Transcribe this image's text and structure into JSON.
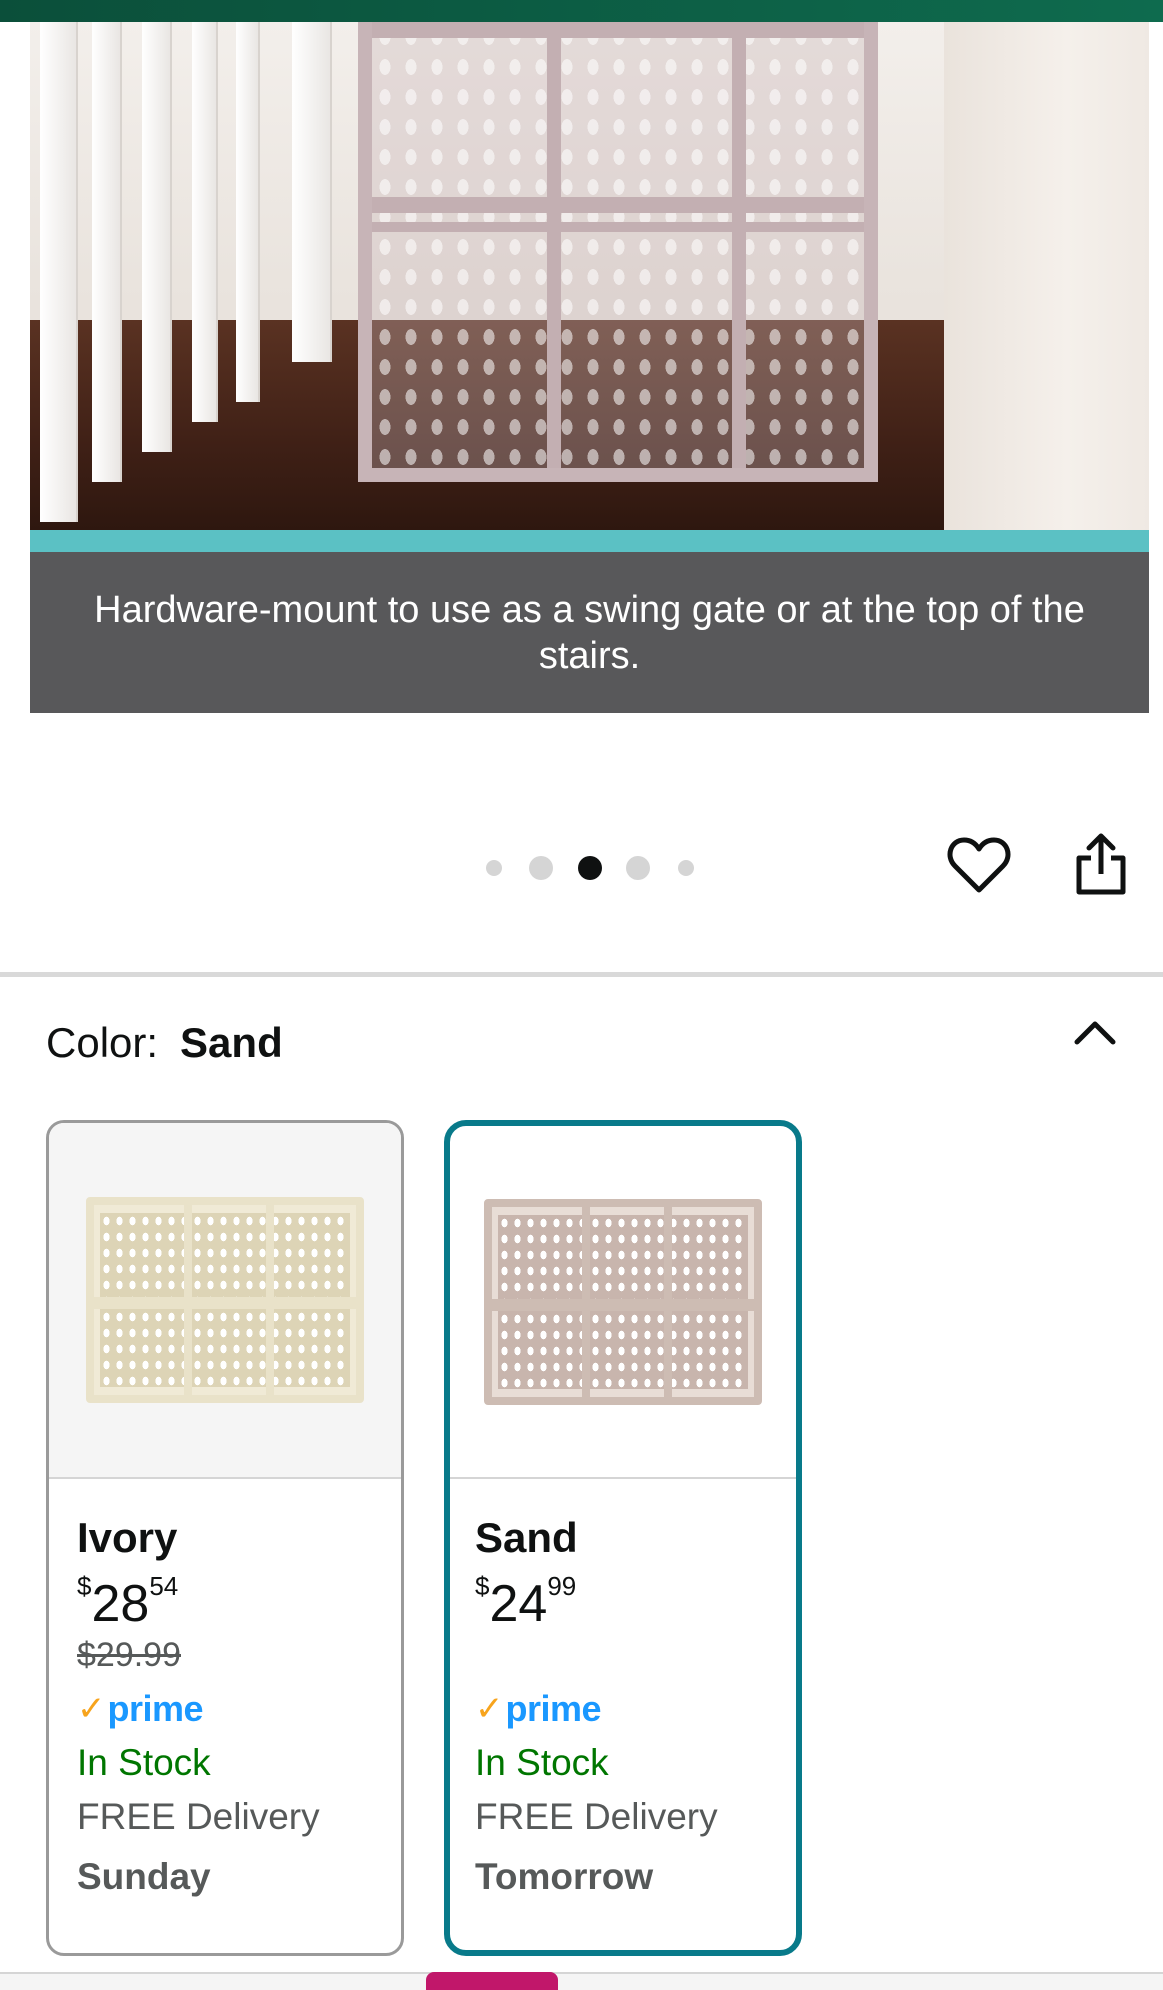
{
  "hero": {
    "caption": "Hardware-mount to use as a swing gate or at the top of the stairs.",
    "image_count": 5,
    "active_index": 2
  },
  "actions": {
    "favorite_icon": "heart-outline-icon",
    "share_icon": "share-icon"
  },
  "color_selector": {
    "label": "Color:",
    "selected_value": "Sand",
    "collapse_icon": "chevron-up-icon"
  },
  "swatches": [
    {
      "name": "Ivory",
      "price_currency": "$",
      "price_whole": "28",
      "price_fraction": "54",
      "list_price": "$29.99",
      "prime_label": "prime",
      "stock": "In Stock",
      "delivery": "FREE Delivery",
      "delivery_day": "Sunday",
      "selected": false,
      "gate_color": "#e9e2c9"
    },
    {
      "name": "Sand",
      "price_currency": "$",
      "price_whole": "24",
      "price_fraction": "99",
      "list_price": "",
      "prime_label": "prime",
      "stock": "In Stock",
      "delivery": "FREE Delivery",
      "delivery_day": "Tomorrow",
      "selected": true,
      "gate_color": "#cdbcb3"
    }
  ],
  "colors": {
    "selected_border": "#087a8a",
    "in_stock": "#007600",
    "prime_blue": "#1a98ff",
    "prime_check": "#f7a41d"
  }
}
